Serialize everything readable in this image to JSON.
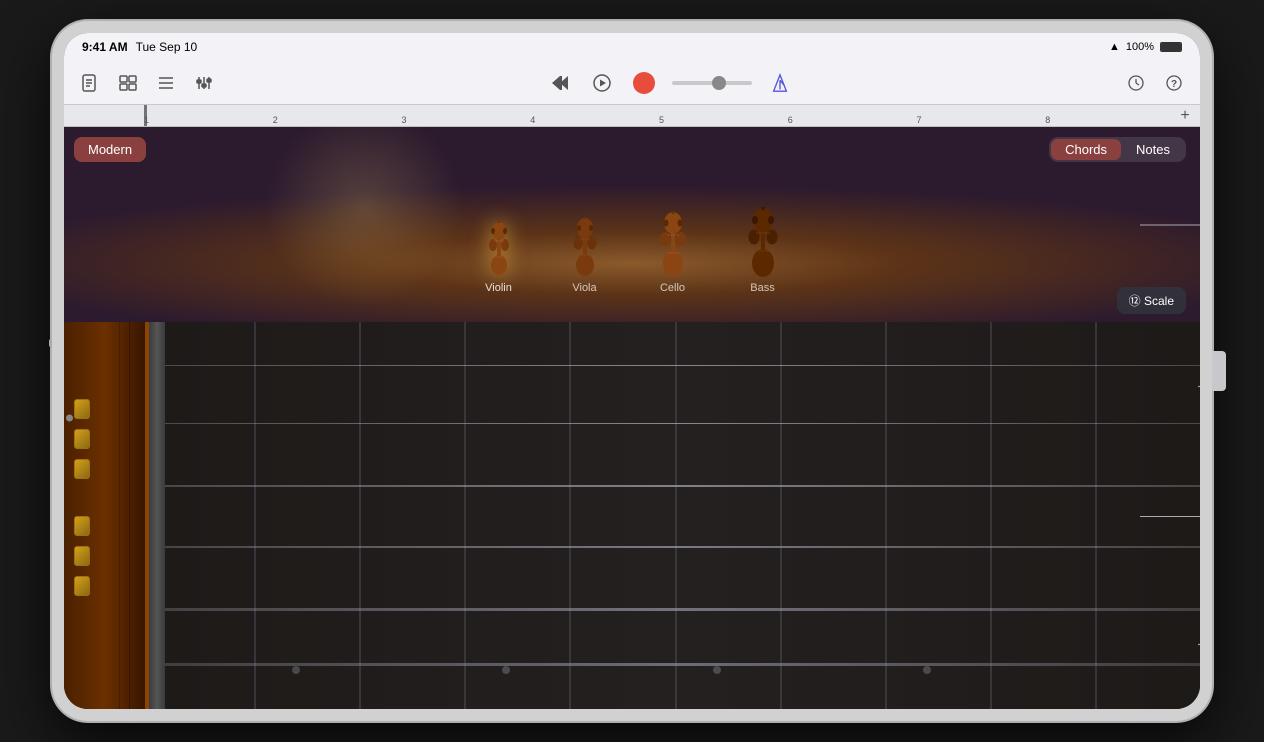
{
  "device": {
    "status_bar": {
      "time": "9:41 AM",
      "date": "Tue Sep 10",
      "battery": "100%",
      "wifi": "WiFi"
    }
  },
  "toolbar": {
    "buttons": {
      "new_song": "🗒",
      "tracks_view": "⬜",
      "song_settings": "☰",
      "mixer": "🎛",
      "rewind": "⏮",
      "play": "▶",
      "record": "●",
      "settings": "⚙",
      "help": "?"
    }
  },
  "timeline": {
    "add_label": "+",
    "marks": [
      "1",
      "2",
      "3",
      "4",
      "5",
      "6",
      "7",
      "8"
    ]
  },
  "upper_panel": {
    "preset_label": "Modern",
    "chords_label": "Chords",
    "notes_label": "Notes",
    "scale_label": "⑫ Scale",
    "instruments": [
      {
        "id": "violin",
        "label": "Violin",
        "selected": true
      },
      {
        "id": "viola",
        "label": "Viola",
        "selected": false
      },
      {
        "id": "cello",
        "label": "Cello",
        "selected": false
      },
      {
        "id": "bass",
        "label": "Bass",
        "selected": false
      }
    ]
  },
  "lower_panel": {
    "frets": 12,
    "strings": 6,
    "scroll_dots": 4
  },
  "colors": {
    "accent_red": "#8b4040",
    "record_red": "#e74c3c",
    "guitar_wood": "#5c2800",
    "metronome_blue": "#5856d6",
    "stage_floor": "#8b5a2b"
  }
}
